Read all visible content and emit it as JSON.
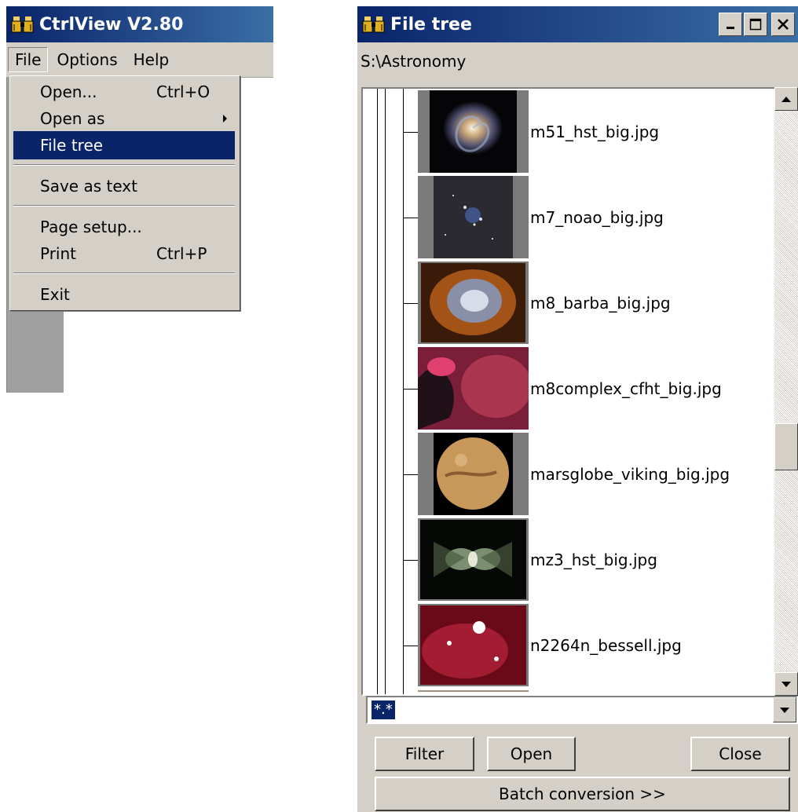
{
  "main_window": {
    "title": "CtrlView V2.80",
    "menubar": [
      "File",
      "Options",
      "Help"
    ]
  },
  "file_menu": {
    "items": [
      {
        "label": "Open...",
        "shortcut": "Ctrl+O"
      },
      {
        "label": "Open as",
        "shortcut": ""
      },
      {
        "label": "File tree",
        "shortcut": "",
        "selected": true
      },
      {
        "label": "Save as text",
        "shortcut": ""
      },
      {
        "label": "Page setup...",
        "shortcut": ""
      },
      {
        "label": "Print",
        "shortcut": "Ctrl+P"
      },
      {
        "label": "Exit",
        "shortcut": ""
      }
    ]
  },
  "tree_window": {
    "title": "File tree",
    "path": "S:\\Astronomy",
    "files": [
      "m51_hst_big.jpg",
      "m7_noao_big.jpg",
      "m8_barba_big.jpg",
      "m8complex_cfht_big.jpg",
      "marsglobe_viking_big.jpg",
      "mz3_hst_big.jpg",
      "n2264n_bessell.jpg"
    ],
    "filter": "*.*",
    "buttons": {
      "filter": "Filter",
      "open": "Open",
      "close": "Close",
      "batch": "Batch conversion >>"
    }
  },
  "colors": {
    "titlebar_start": "#0a246a",
    "titlebar_end": "#3a6ea5",
    "face": "#d4d0c8",
    "selection": "#0a246a"
  }
}
